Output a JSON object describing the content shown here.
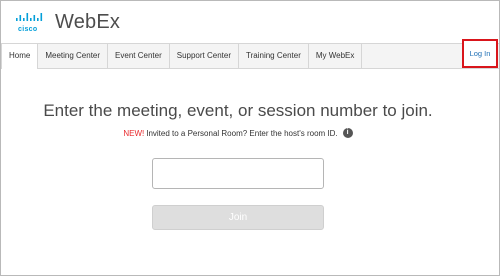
{
  "header": {
    "logo_word": "cisco",
    "brand": "WebEx",
    "brand_color": "#049fd9"
  },
  "tabs": [
    {
      "label": "Home",
      "active": true
    },
    {
      "label": "Meeting Center"
    },
    {
      "label": "Event Center"
    },
    {
      "label": "Support Center"
    },
    {
      "label": "Training Center"
    },
    {
      "label": "My WebEx"
    }
  ],
  "login": {
    "label": "Log In",
    "highlight_color": "#d9151b"
  },
  "main": {
    "heading": "Enter the meeting, event, or session number to join.",
    "new_tag": "NEW!",
    "subtext": "Invited to a Personal Room? Enter the host's room ID.",
    "info_icon": "info-icon",
    "meeting_input": {
      "value": "",
      "placeholder": ""
    },
    "join_label": "Join"
  }
}
